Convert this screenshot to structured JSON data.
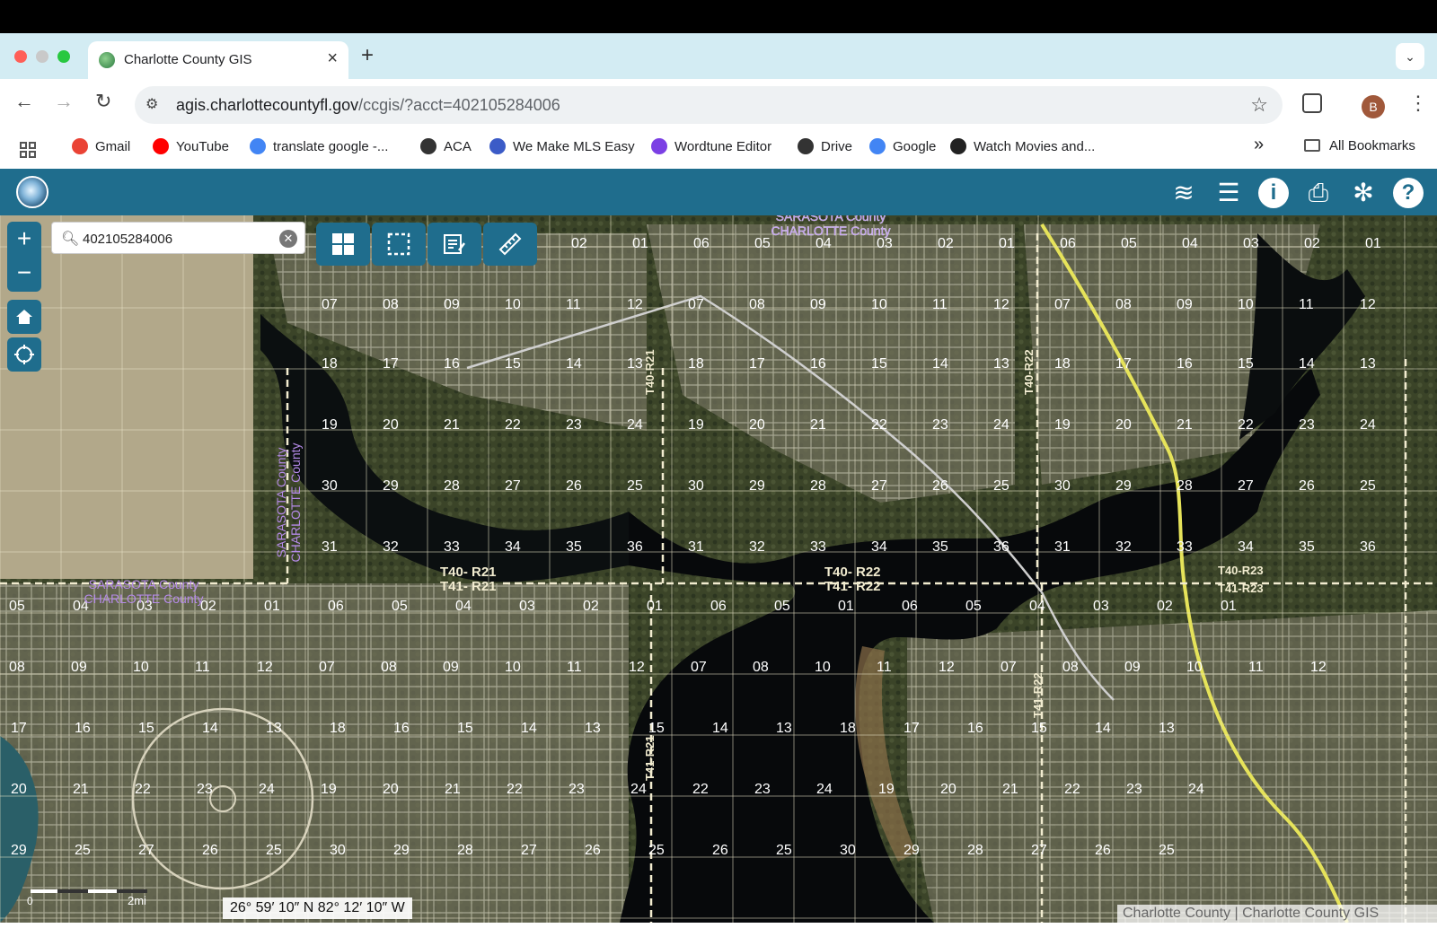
{
  "browser": {
    "tab_title": "Charlotte County GIS",
    "tab_close": "×",
    "new_tab": "+",
    "tab_dropdown": "⌄",
    "url_host": "agis.charlottecountyfl.gov",
    "url_path": "/ccgis/?acct=402105284006",
    "nav": {
      "back": "←",
      "forward": "→",
      "reload": "↻"
    },
    "profile_initial": "B",
    "bookmarks": [
      {
        "label": "Gmail",
        "icon": "gmail-icon",
        "color": "#ea4335"
      },
      {
        "label": "YouTube",
        "icon": "youtube-icon",
        "color": "#ff0000"
      },
      {
        "label": "translate google -...",
        "icon": "google-icon",
        "color": "#4285f4"
      },
      {
        "label": "ACA",
        "icon": "globe-icon",
        "color": "#333333"
      },
      {
        "label": "We Make MLS Easy",
        "icon": "gear-icon",
        "color": "#3b5bc7"
      },
      {
        "label": "Wordtune Editor",
        "icon": "wordtune-icon",
        "color": "#7b3fe4"
      },
      {
        "label": "Drive",
        "icon": "globe-icon",
        "color": "#333333"
      },
      {
        "label": "Google",
        "icon": "google-icon",
        "color": "#4285f4"
      },
      {
        "label": "Watch Movies and...",
        "icon": "movie-icon",
        "color": "#222222"
      }
    ],
    "overflow": "»",
    "all_bookmarks": "All Bookmarks"
  },
  "gis": {
    "tools": [
      "layers-icon",
      "legend-icon",
      "info-icon",
      "print-icon",
      "settings-icon",
      "help-icon"
    ],
    "search_value": "402105284006",
    "zoom_in": "+",
    "zoom_out": "−",
    "coordinates": "26° 59′ 10″ N 82° 12′ 10″ W",
    "scale_start": "0",
    "scale_end": "2mi",
    "attribution": "Charlotte County | Charlotte County GIS",
    "county_labels": {
      "sarasota_top": "SARASOTA County",
      "charlotte_top": "CHARLOTTE County",
      "sarasota_left": "SARASOTA County",
      "charlotte_left": "CHARLOTTE County",
      "sarasota_vertical": "SARASOTA County",
      "charlotte_vertical": "CHARLOTTE County"
    },
    "township_labels": [
      "T40- R21",
      "T41- R21",
      "T40- R22",
      "T41- R22",
      "T40-R21",
      "T40-R22",
      "T41-R21",
      "T41-R22",
      "T40-R23",
      "T41-R23"
    ],
    "sections_row1": [
      "02",
      "01",
      "06",
      "05",
      "04",
      "03",
      "02",
      "01",
      "06",
      "05",
      "04",
      "03",
      "02",
      "01"
    ],
    "sections_row2": [
      "07",
      "08",
      "09",
      "10",
      "11",
      "12",
      "07",
      "08",
      "09",
      "10",
      "11",
      "12",
      "07",
      "08",
      "09",
      "10",
      "11",
      "12"
    ],
    "sections_row3": [
      "18",
      "17",
      "16",
      "15",
      "14",
      "13",
      "18",
      "17",
      "16",
      "15",
      "14",
      "13",
      "18",
      "17",
      "16",
      "15",
      "14",
      "13"
    ],
    "sections_row4": [
      "19",
      "20",
      "21",
      "22",
      "23",
      "24",
      "19",
      "20",
      "21",
      "22",
      "23",
      "24",
      "19",
      "20",
      "21",
      "22",
      "23",
      "24"
    ],
    "sections_row5": [
      "30",
      "29",
      "28",
      "27",
      "26",
      "25",
      "30",
      "29",
      "28",
      "27",
      "26",
      "25",
      "30",
      "29",
      "28",
      "27",
      "26",
      "25"
    ],
    "sections_row6": [
      "31",
      "32",
      "33",
      "34",
      "35",
      "36",
      "31",
      "32",
      "33",
      "34",
      "35",
      "36",
      "31",
      "32",
      "33",
      "34",
      "35",
      "36"
    ],
    "sections_row7": [
      "05",
      "04",
      "03",
      "02",
      "01",
      "06",
      "05",
      "04",
      "03",
      "02",
      "01",
      "06",
      "05",
      "01",
      "06",
      "05",
      "04",
      "03",
      "02",
      "01"
    ],
    "sections_row8": [
      "08",
      "09",
      "10",
      "11",
      "12",
      "07",
      "08",
      "09",
      "10",
      "11",
      "12",
      "07",
      "08",
      "10",
      "11",
      "12",
      "07",
      "08",
      "09",
      "10",
      "11",
      "12"
    ],
    "sections_row9": [
      "17",
      "16",
      "15",
      "14",
      "13",
      "18",
      "16",
      "15",
      "14",
      "13",
      "15",
      "14",
      "13",
      "18",
      "17",
      "16",
      "15",
      "14",
      "13"
    ],
    "sections_row10": [
      "20",
      "21",
      "22",
      "23",
      "24",
      "19",
      "20",
      "21",
      "22",
      "23",
      "24",
      "22",
      "23",
      "24",
      "19",
      "20",
      "21",
      "22",
      "23",
      "24"
    ],
    "sections_row11": [
      "29",
      "25",
      "27",
      "26",
      "25",
      "30",
      "29",
      "28",
      "27",
      "26",
      "25",
      "26",
      "25",
      "30",
      "29",
      "28",
      "27",
      "26",
      "25"
    ]
  }
}
